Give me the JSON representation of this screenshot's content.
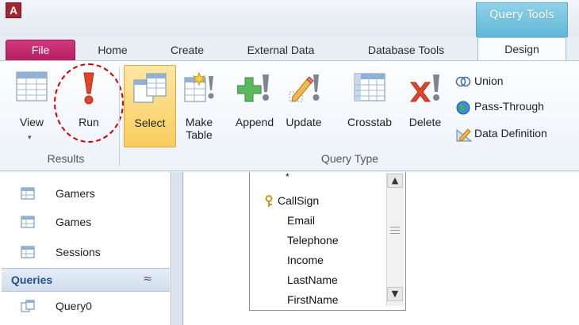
{
  "app": {
    "icon_letter": "A",
    "context_tab_title": "Query Tools"
  },
  "tabs": [
    {
      "label": "File"
    },
    {
      "label": "Home"
    },
    {
      "label": "Create"
    },
    {
      "label": "External Data"
    },
    {
      "label": "Database Tools"
    },
    {
      "label": "Design"
    }
  ],
  "ribbon": {
    "results": {
      "group_label": "Results",
      "view_label": "View",
      "run_label": "Run"
    },
    "query_type": {
      "group_label": "Query Type",
      "select_label": "Select",
      "make_table_label_1": "Make",
      "make_table_label_2": "Table",
      "append_label": "Append",
      "update_label": "Update",
      "crosstab_label": "Crosstab",
      "delete_label": "Delete",
      "union_label": "Union",
      "pass_through_label": "Pass-Through",
      "data_definition_label": "Data Definition"
    }
  },
  "nav_pane": {
    "tables": [
      "Gamers",
      "Games",
      "Sessions"
    ],
    "queries_header": "Queries",
    "queries_chevron": "≈",
    "queries": [
      "Query0"
    ]
  },
  "table_fields": [
    "*",
    "CallSign",
    "Email",
    "Telephone",
    "Income",
    "LastName",
    "FirstName"
  ],
  "colors": {
    "file_tab": "#c62a6e",
    "context_tab": "#6cc0de",
    "select_highlight": "#f9d46f",
    "run_annotation": "#d40000"
  }
}
